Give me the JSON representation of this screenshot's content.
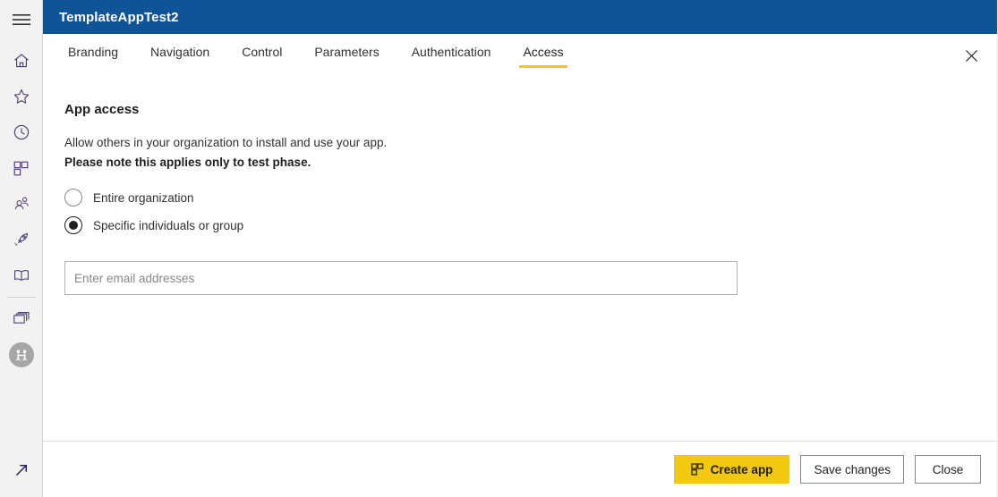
{
  "sidebar": {
    "menu_button": "hamburger-menu",
    "items": [
      {
        "icon": "home-icon",
        "label": "Home"
      },
      {
        "icon": "star-icon",
        "label": "Favorites"
      },
      {
        "icon": "clock-icon",
        "label": "Recent"
      },
      {
        "icon": "apps-grid-icon",
        "label": "Apps"
      },
      {
        "icon": "people-icon",
        "label": "Shared with me"
      },
      {
        "icon": "rocket-icon",
        "label": "Deployment pipelines"
      },
      {
        "icon": "book-icon",
        "label": "Learn"
      }
    ],
    "workspaces": [
      {
        "icon": "workspaces-icon",
        "label": "Workspaces"
      },
      {
        "icon": "workspace-avatar-icon",
        "label": "My workspace"
      }
    ],
    "expand": {
      "icon": "arrow-expand-icon",
      "label": "Expand"
    }
  },
  "header": {
    "title": "TemplateAppTest2",
    "close_icon": "close-icon",
    "accent_color": "#f2c811",
    "bar_color": "#0f5497"
  },
  "tabs": [
    {
      "label": "Branding",
      "active": false
    },
    {
      "label": "Navigation",
      "active": false
    },
    {
      "label": "Control",
      "active": false
    },
    {
      "label": "Parameters",
      "active": false
    },
    {
      "label": "Authentication",
      "active": false
    },
    {
      "label": "Access",
      "active": true
    }
  ],
  "main": {
    "section_title": "App access",
    "description_line1": "Allow others in your organization to install and use your app.",
    "description_line2": "Please note this applies only to test phase.",
    "options": [
      {
        "label": "Entire organization",
        "checked": false
      },
      {
        "label": "Specific individuals or group",
        "checked": true
      }
    ],
    "email_input": {
      "placeholder": "Enter email addresses",
      "value": ""
    }
  },
  "footer": {
    "create_app_label": "Create app",
    "create_app_icon": "apps-grid-icon",
    "save_changes_label": "Save changes",
    "close_label": "Close"
  }
}
